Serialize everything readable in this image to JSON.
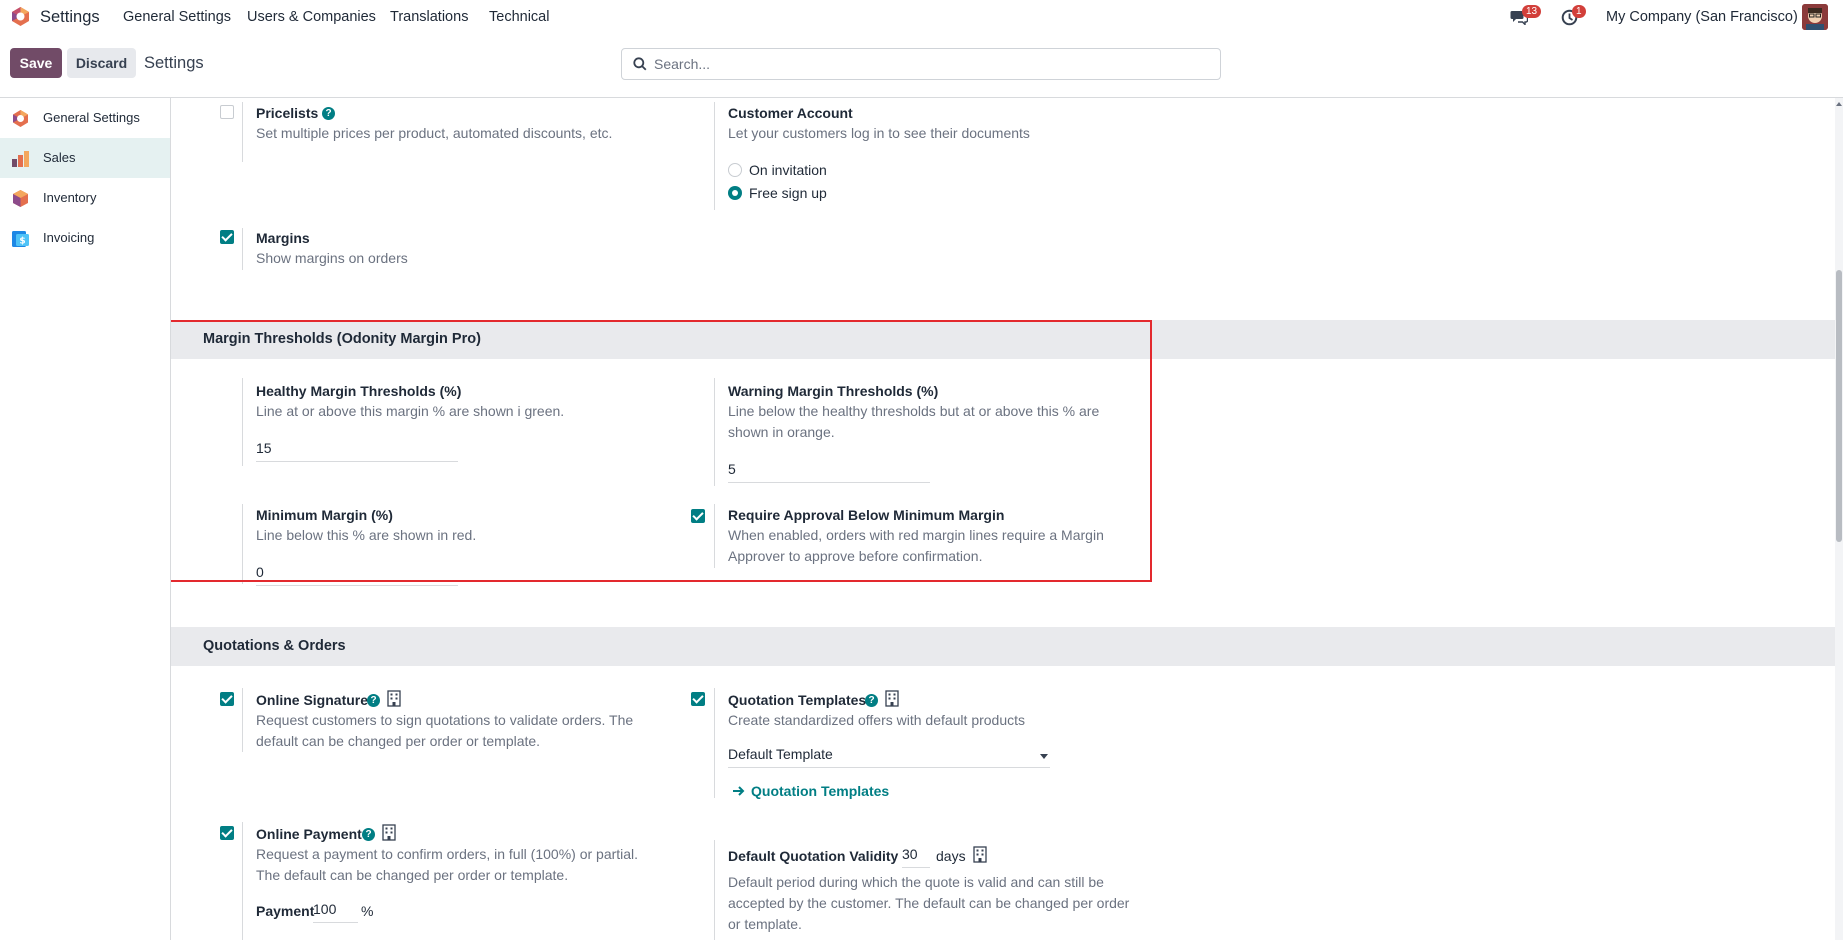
{
  "navbar": {
    "app_name": "Settings",
    "menu": [
      "General Settings",
      "Users & Companies",
      "Translations",
      "Technical"
    ],
    "messages_badge": "13",
    "activity_badge": "1",
    "company": "My Company (San Francisco)"
  },
  "control_panel": {
    "save_label": "Save",
    "discard_label": "Discard",
    "title": "Settings",
    "search_placeholder": "Search..."
  },
  "sidebar": {
    "items": [
      {
        "label": "General Settings",
        "icon": "settings-app-icon",
        "active": false
      },
      {
        "label": "Sales",
        "icon": "sales-app-icon",
        "active": true
      },
      {
        "label": "Inventory",
        "icon": "inventory-app-icon",
        "active": false
      },
      {
        "label": "Invoicing",
        "icon": "invoicing-app-icon",
        "active": false
      }
    ]
  },
  "pricing": {
    "pricelists": {
      "title": "Pricelists",
      "desc": "Set multiple prices per product, automated discounts, etc.",
      "checked": false
    },
    "customer_account": {
      "title": "Customer Account",
      "desc": "Let your customers log in to see their documents",
      "options": [
        "On invitation",
        "Free sign up"
      ],
      "selected": "Free sign up"
    },
    "margins": {
      "title": "Margins",
      "desc": "Show margins on orders",
      "checked": true
    }
  },
  "margin_thresholds": {
    "heading": "Margin Thresholds (Odonity Margin Pro)",
    "healthy": {
      "title": "Healthy Margin Thresholds (%)",
      "desc": "Line at or above this margin % are shown i green.",
      "value": "15"
    },
    "warning": {
      "title": "Warning Margin Thresholds (%)",
      "desc": "Line below the healthy thresholds but at or above this % are shown in orange.",
      "value": "5"
    },
    "minimum": {
      "title": "Minimum Margin (%)",
      "desc": "Line below this % are shown in red.",
      "value": "0"
    },
    "approval": {
      "title": "Require Approval Below Minimum Margin",
      "desc": "When enabled, orders with red margin lines require a Margin Approver to approve before confirmation.",
      "checked": true
    }
  },
  "quotations": {
    "heading": "Quotations & Orders",
    "online_signature": {
      "title": "Online Signature",
      "desc": "Request customers to sign quotations to validate orders. The default can be changed per order or template.",
      "checked": true
    },
    "quotation_templates": {
      "title": "Quotation Templates",
      "desc": "Create standardized offers with default products",
      "checked": true,
      "default_label": "Default Template",
      "link": "Quotation Templates"
    },
    "online_payment": {
      "title": "Online Payment",
      "desc": "Request a payment to confirm orders, in full (100%) or partial. The default can be changed per order or template.",
      "checked": true,
      "payment_label": "Payment",
      "payment_value": "100",
      "payment_unit": "%"
    },
    "validity": {
      "title": "Default Quotation Validity",
      "value": "30",
      "unit": "days",
      "desc": "Default period during which the quote is valid and can still be accepted by the customer. The default can be changed per order or template."
    }
  },
  "colors": {
    "primary": "#714b67",
    "accent": "#017e84",
    "highlight_border": "#e3292e"
  }
}
